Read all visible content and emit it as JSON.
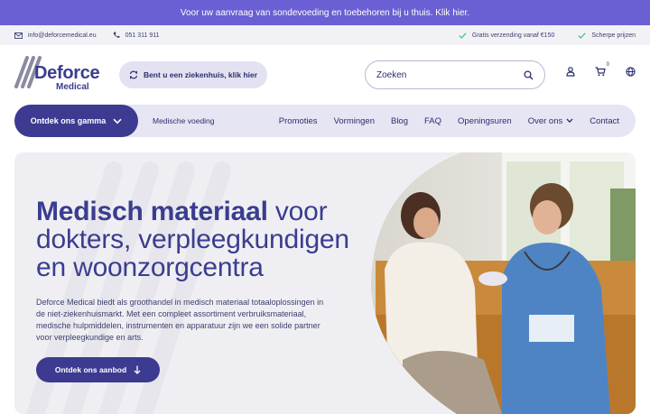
{
  "announcement": "Voor uw aanvraag van sondevoeding en toebehoren bij u thuis. Klik hier.",
  "infobar": {
    "email": "info@deforcemedical.eu",
    "phone": "051 311 911",
    "shipping": "Gratis verzending vanaf €150",
    "prices": "Scherpe prijzen"
  },
  "header": {
    "logo_line1": "Deforce",
    "logo_line2": "Medical",
    "hospital_button": "Bent u een ziekenhuis, klik hier",
    "search_placeholder": "Zoeken",
    "cart_count": "0"
  },
  "nav": {
    "gamma_button": "Ontdek ons gamma",
    "medisch": "Medische voeding",
    "links": [
      "Promoties",
      "Vormingen",
      "Blog",
      "FAQ",
      "Openingsuren",
      "Over ons",
      "Contact"
    ]
  },
  "hero": {
    "title_bold": "Medisch materiaal",
    "title_rest": " voor dokters, verpleegkundigen en woonzorgcentra",
    "text": "Deforce Medical biedt als groothandel in medisch materiaal totaaloplossingen in de niet-ziekenhuismarkt. Met een compleet assortiment verbruiksmateriaal, medische hulpmiddelen, instrumenten en apparatuur zijn we een solide partner voor verpleegkundige en arts.",
    "cta": "Ontdek ons aanbod"
  },
  "colors": {
    "announce_bg": "#6a5fd3",
    "brand_dark": "#3d3a91",
    "nav_bg": "#e6e5f3",
    "check_green": "#3fbf7f"
  }
}
